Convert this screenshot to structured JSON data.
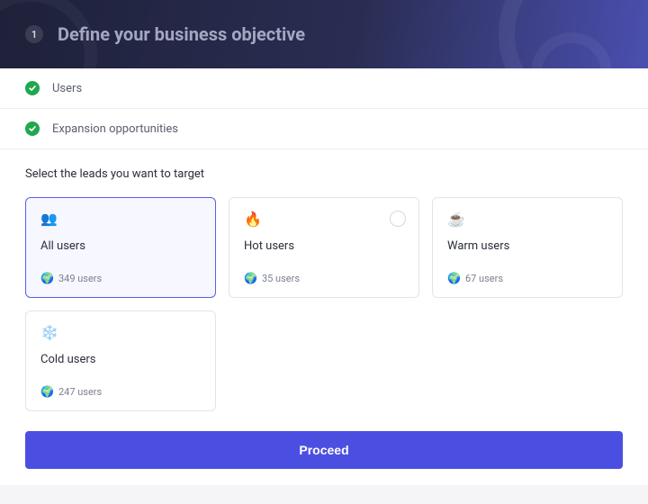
{
  "header": {
    "step_number": "1",
    "title": "Define your business objective"
  },
  "checks": [
    {
      "label": "Users"
    },
    {
      "label": "Expansion opportunities"
    }
  ],
  "section": {
    "title": "Select the leads you want to target"
  },
  "cards": [
    {
      "icon": "users-icon",
      "glyph": "👥",
      "title": "All users",
      "meta_glyph": "🌍",
      "meta": "349 users",
      "selected": true
    },
    {
      "icon": "fire-icon",
      "glyph": "🔥",
      "title": "Hot users",
      "meta_glyph": "🌍",
      "meta": "35 users",
      "selected": false,
      "show_radio": true
    },
    {
      "icon": "coffee-icon",
      "glyph": "☕",
      "title": "Warm users",
      "meta_glyph": "🌍",
      "meta": "67 users",
      "selected": false
    },
    {
      "icon": "snowflake-icon",
      "glyph": "❄️",
      "title": "Cold users",
      "meta_glyph": "🌍",
      "meta": "247 users",
      "selected": false
    }
  ],
  "footer": {
    "proceed_label": "Proceed"
  }
}
